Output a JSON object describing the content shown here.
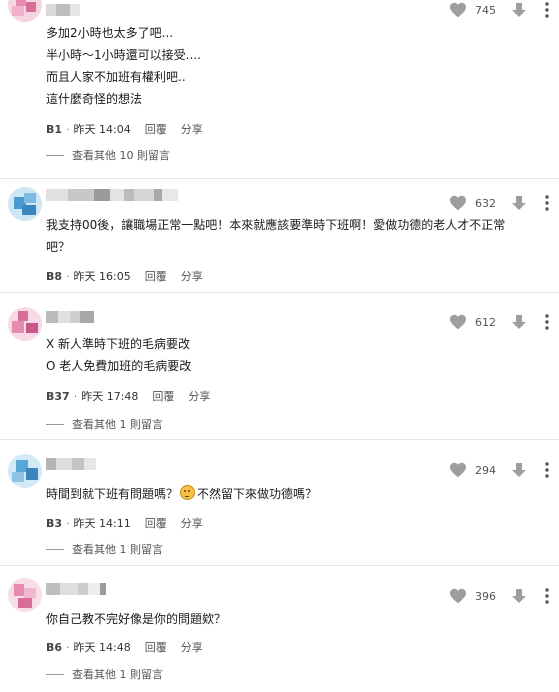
{
  "comments": [
    {
      "likes": "745",
      "lines": [
        "多加2小時也太多了吧...",
        "半小時～1小時還可以接受....",
        "而且人家不加班有權利吧..",
        "這什麼奇怪的想法"
      ],
      "floor": "B1",
      "time": "昨天 14:04",
      "reply": "回覆",
      "share": "分享",
      "more": "查看其他 10 則留言"
    },
    {
      "likes": "632",
      "lines": [
        "我支持00後，讓職場正常一點吧！本來就應該要準時下班啊！愛做功德的老人才不正常",
        "吧？"
      ],
      "floor": "B8",
      "time": "昨天 16:05",
      "reply": "回覆",
      "share": "分享"
    },
    {
      "likes": "612",
      "lines": [
        "X 新人準時下班的毛病要改",
        "O 老人免費加班的毛病要改"
      ],
      "floor": "B37",
      "time": "昨天 17:48",
      "reply": "回覆",
      "share": "分享",
      "more": "查看其他 1 則留言"
    },
    {
      "likes": "294",
      "line_before_emoji": "時間到就下班有問題嗎？",
      "line_after_emoji": "不然留下來做功德嗎？",
      "floor": "B3",
      "time": "昨天 14:11",
      "reply": "回覆",
      "share": "分享",
      "more": "查看其他 1 則留言"
    },
    {
      "likes": "396",
      "lines": [
        "你自己教不完好像是你的問題欸？"
      ],
      "floor": "B6",
      "time": "昨天 14:48",
      "reply": "回覆",
      "share": "分享",
      "more": "查看其他 1 則留言"
    }
  ],
  "separator": "·",
  "icons": {
    "like": "heart-icon",
    "dislike": "thumb-down-arrow-icon",
    "more": "more-vertical-icon",
    "emoji": "emoji-face-icon"
  },
  "colors": {
    "icon_gray": "#9e9e9e",
    "avatar_pink": "#e58ab0",
    "avatar_blue": "#4a9bd1"
  }
}
